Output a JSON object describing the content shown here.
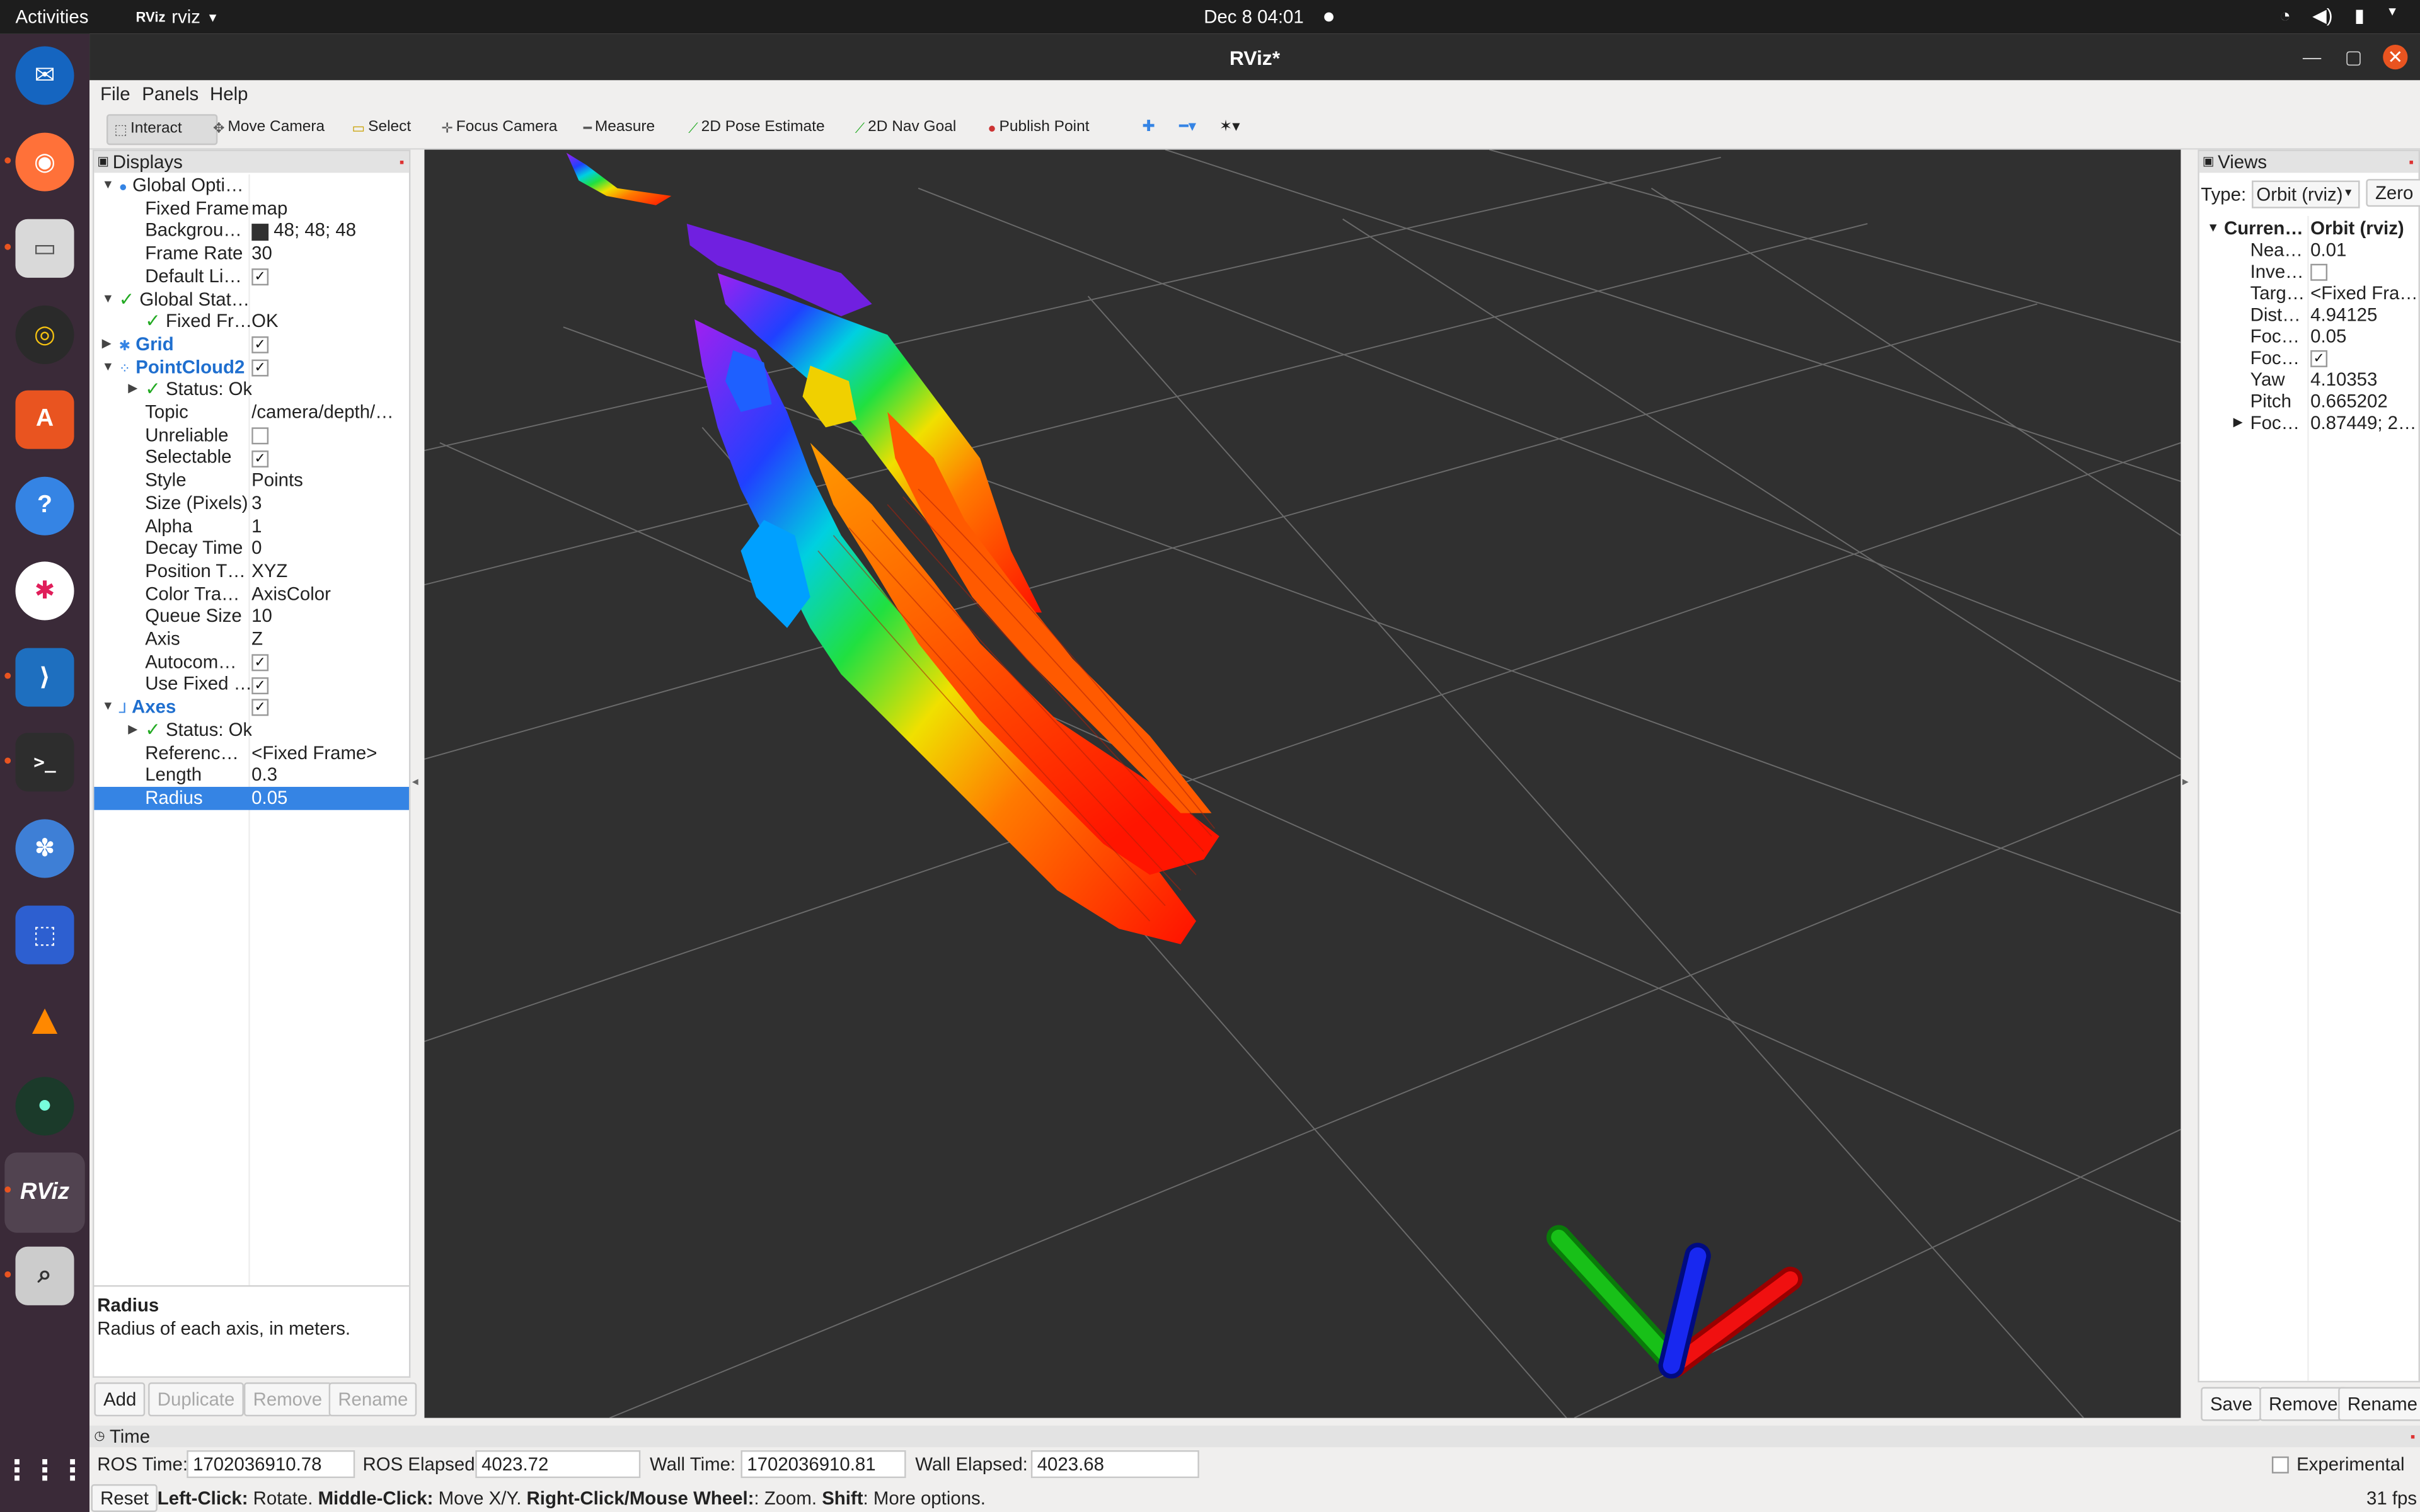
{
  "topbar": {
    "activities": "Activities",
    "app_name": "rviz",
    "clock": "Dec 8  04:01"
  },
  "window": {
    "title": "RViz*"
  },
  "menu": [
    "File",
    "Panels",
    "Help"
  ],
  "toolbar": [
    {
      "label": "Interact",
      "active": true
    },
    {
      "label": "Move Camera"
    },
    {
      "label": "Select"
    },
    {
      "label": "Focus Camera"
    },
    {
      "label": "Measure"
    },
    {
      "label": "2D Pose Estimate"
    },
    {
      "label": "2D Nav Goal"
    },
    {
      "label": "Publish Point"
    }
  ],
  "displays": {
    "header": "Displays",
    "rows": [
      {
        "key": "Global Opti…",
        "value": ""
      },
      {
        "key": "Fixed Frame",
        "value": "map"
      },
      {
        "key": "Backgrou…",
        "value": "48; 48; 48"
      },
      {
        "key": "Frame Rate",
        "value": "30"
      },
      {
        "key": "Default Li…",
        "value": ""
      },
      {
        "key": "Global Stat…",
        "value": ""
      },
      {
        "key": "Fixed Fr…",
        "value": "OK"
      },
      {
        "key": "Grid",
        "value": ""
      },
      {
        "key": "PointCloud2",
        "value": ""
      },
      {
        "key": "Status: Ok",
        "value": ""
      },
      {
        "key": "Topic",
        "value": "/camera/depth/…"
      },
      {
        "key": "Unreliable",
        "value": ""
      },
      {
        "key": "Selectable",
        "value": ""
      },
      {
        "key": "Style",
        "value": "Points"
      },
      {
        "key": "Size (Pixels)",
        "value": "3"
      },
      {
        "key": "Alpha",
        "value": "1"
      },
      {
        "key": "Decay Time",
        "value": "0"
      },
      {
        "key": "Position T…",
        "value": "XYZ"
      },
      {
        "key": "Color Tra…",
        "value": "AxisColor"
      },
      {
        "key": "Queue Size",
        "value": "10"
      },
      {
        "key": "Axis",
        "value": "Z"
      },
      {
        "key": "Autocom…",
        "value": ""
      },
      {
        "key": "Use Fixed …",
        "value": ""
      },
      {
        "key": "Axes",
        "value": ""
      },
      {
        "key": "Status: Ok",
        "value": ""
      },
      {
        "key": "Referenc…",
        "value": "<Fixed Frame>"
      },
      {
        "key": "Length",
        "value": "0.3"
      },
      {
        "key": "Radius",
        "value": "0.05"
      }
    ],
    "description_title": "Radius",
    "description_text": "Radius of each axis, in meters.",
    "buttons": [
      "Add",
      "Duplicate",
      "Remove",
      "Rename"
    ]
  },
  "views": {
    "header": "Views",
    "type_label": "Type:",
    "type_value": "Orbit (rviz)",
    "zero_button": "Zero",
    "current_key": "Curren…",
    "current_value": "Orbit (rviz)",
    "rows": [
      {
        "key": "Nea…",
        "value": "0.01"
      },
      {
        "key": "Inve…",
        "value": ""
      },
      {
        "key": "Targ…",
        "value": "<Fixed Fra…"
      },
      {
        "key": "Dist…",
        "value": "4.94125"
      },
      {
        "key": "Foc…",
        "value": "0.05"
      },
      {
        "key": "Foc…",
        "value": ""
      },
      {
        "key": "Yaw",
        "value": "4.10353"
      },
      {
        "key": "Pitch",
        "value": "0.665202"
      },
      {
        "key": "Foc…",
        "value": "0.87449; 2…"
      }
    ],
    "buttons": [
      "Save",
      "Remove",
      "Rename"
    ]
  },
  "time": {
    "header": "Time",
    "ros_time_label": "ROS Time:",
    "ros_time": "1702036910.78",
    "ros_elapsed_label": "ROS Elapsed:",
    "ros_elapsed": "4023.72",
    "wall_time_label": "Wall Time:",
    "wall_time": "1702036910.81",
    "wall_elapsed_label": "Wall Elapsed:",
    "wall_elapsed": "4023.68",
    "experimental": "Experimental"
  },
  "statusbar": {
    "reset": "Reset",
    "left_click": "Left-Click:",
    "left_click_desc": " Rotate. ",
    "middle_click": "Middle-Click:",
    "middle_click_desc": " Move X/Y. ",
    "right_click": "Right-Click/Mouse Wheel:",
    "right_click_desc": ": Zoom. ",
    "shift": "Shift",
    "shift_desc": ": More options.",
    "fps": "31 fps"
  },
  "colors": {
    "viewport_bg": "#303030",
    "axis_x": "#e01010",
    "axis_y": "#10b010",
    "axis_z": "#1020e0",
    "selection": "#3584e4",
    "close_button": "#e95420"
  }
}
